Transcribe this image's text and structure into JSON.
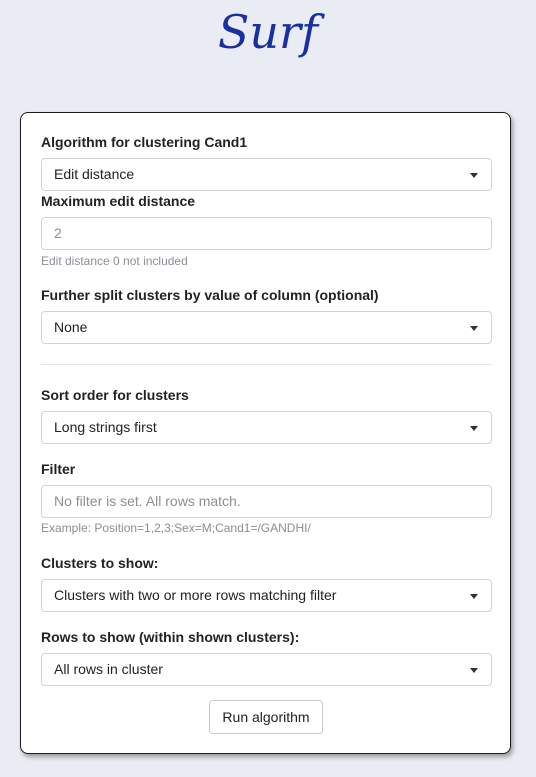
{
  "app": {
    "logo_text": "Surf",
    "colors": {
      "logo": "#1a2fa0",
      "page_background": "#e9edf3",
      "card_background": "#ffffff"
    }
  },
  "form": {
    "algorithm": {
      "label": "Algorithm for clustering Cand1",
      "selected": "Edit distance"
    },
    "max_edit_distance": {
      "label": "Maximum edit distance",
      "placeholder": "2",
      "help": "Edit distance 0 not included"
    },
    "split_column": {
      "label": "Further split clusters by value of column (optional)",
      "selected": "None"
    },
    "sort_order": {
      "label": "Sort order for clusters",
      "selected": "Long strings first"
    },
    "filter": {
      "label": "Filter",
      "placeholder": "No filter is set. All rows match.",
      "help": "Example: Position=1,2,3;Sex=M;Cand1=/GANDHI/"
    },
    "clusters_to_show": {
      "label": "Clusters to show:",
      "selected": "Clusters with two or more rows matching filter"
    },
    "rows_to_show": {
      "label": "Rows to show (within shown clusters):",
      "selected": "All rows in cluster"
    },
    "run_button": "Run algorithm"
  }
}
